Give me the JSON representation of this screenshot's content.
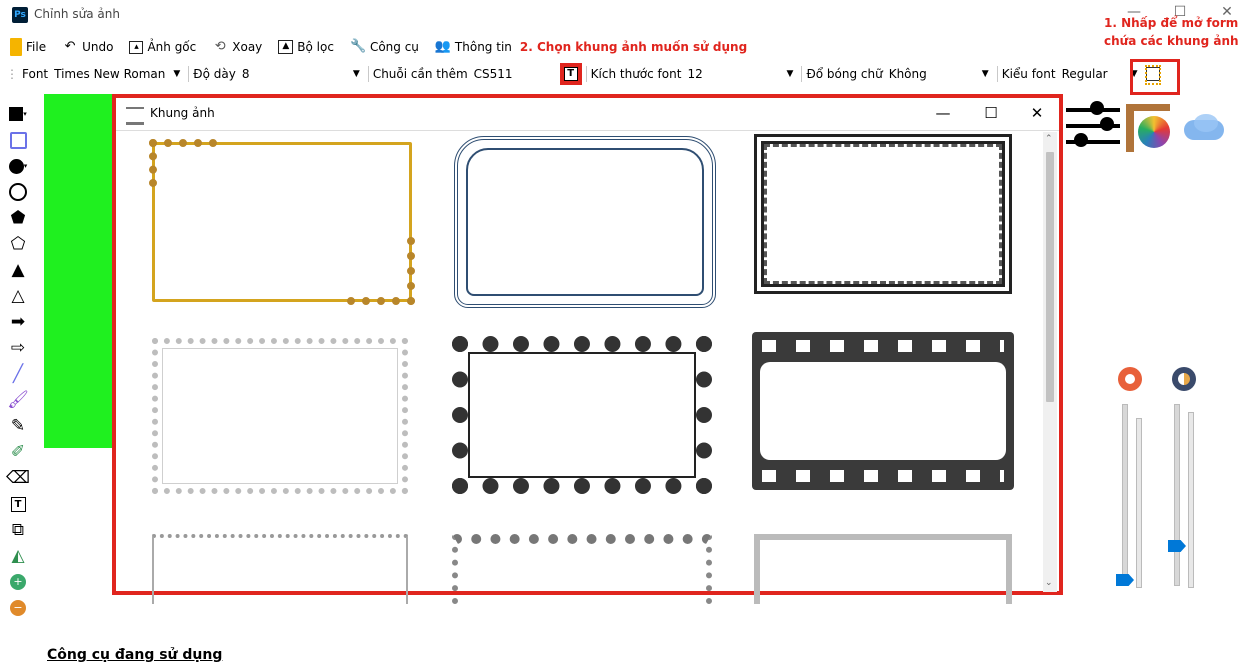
{
  "window": {
    "title": "Chỉnh sửa ảnh",
    "app_icon": "Ps"
  },
  "annotations": {
    "step1_line1": "1. Nhấp để mở form",
    "step1_line2": "chứa các khung ảnh",
    "step2": "2. Chọn khung ảnh muốn sử dụng",
    "color": "#e0251e"
  },
  "menu": [
    {
      "label": "File",
      "icon": "file-icon"
    },
    {
      "label": "Undo",
      "icon": "undo-icon"
    },
    {
      "label": "Ảnh gốc",
      "icon": "image-icon"
    },
    {
      "label": "Xoay",
      "icon": "rotate-icon"
    },
    {
      "label": "Bộ lọc",
      "icon": "filter-icon"
    },
    {
      "label": "Công cụ",
      "icon": "tools-icon"
    },
    {
      "label": "Thông tin",
      "icon": "info-icon"
    }
  ],
  "toolbar": {
    "font_label": "Font",
    "font_value": "Times New Roman",
    "thickness_label": "Độ dày",
    "thickness_value": "8",
    "string_label": "Chuỗi cần thêm",
    "string_value": "CS511",
    "font_size_label": "Kích thước font",
    "font_size_value": "12",
    "shadow_label": "Đổ bóng chữ",
    "shadow_value": "Không",
    "font_style_label": "Kiểu font",
    "font_style_value": "Regular"
  },
  "dialog": {
    "title": "Khung ảnh"
  },
  "status": {
    "current_tool": "Công cụ đang sử dụng"
  },
  "colors": {
    "canvas": "#1ff01f",
    "accent": "#0078d7"
  }
}
